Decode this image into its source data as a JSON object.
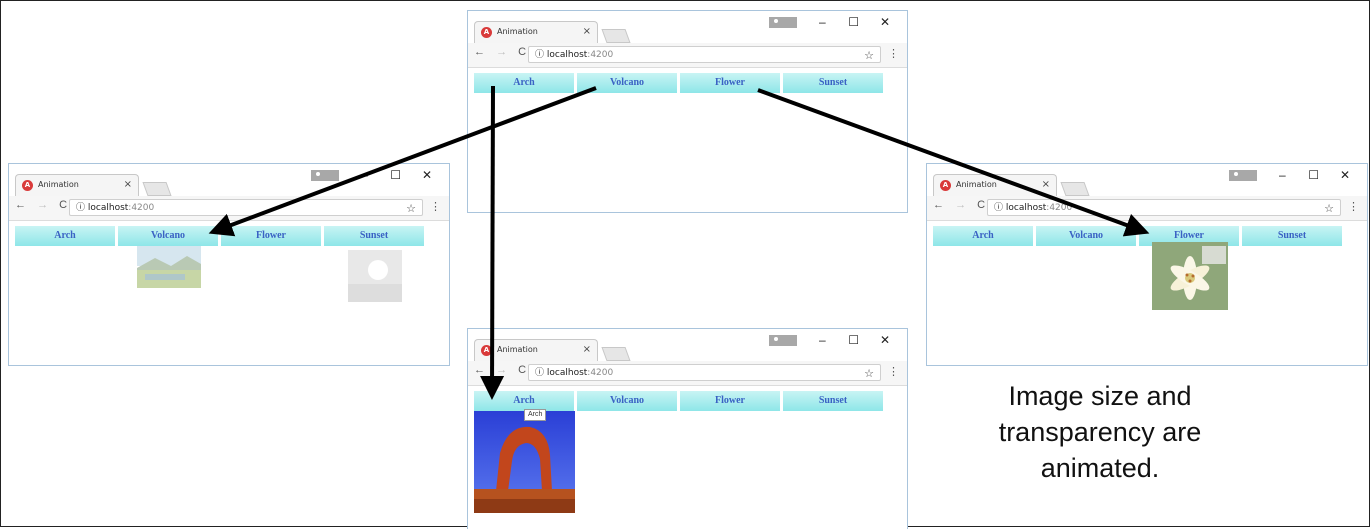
{
  "tab_title": "Animation",
  "tab_close": "×",
  "tab_icon_letter": "A",
  "nav": {
    "back": "←",
    "forward": "→",
    "reload": "C"
  },
  "address": {
    "info_icon": "ⓘ",
    "host": "localhost",
    "port": ":4200"
  },
  "star_icon": "☆",
  "menu_icon": "⋮",
  "window_controls": {
    "minimize": "–",
    "maximize": "☐",
    "close": "✕"
  },
  "buttons": [
    "Arch",
    "Volcano",
    "Flower",
    "Sunset"
  ],
  "tooltip": "Arch",
  "caption": [
    "Image size and",
    "transparency are",
    "animated."
  ],
  "colors": {
    "button_top": "#c8f4f4",
    "button_bottom": "#8ee6e8",
    "button_text": "#3a62c4",
    "window_border": "#a9c4dc",
    "angular_red": "#d93a3a"
  }
}
